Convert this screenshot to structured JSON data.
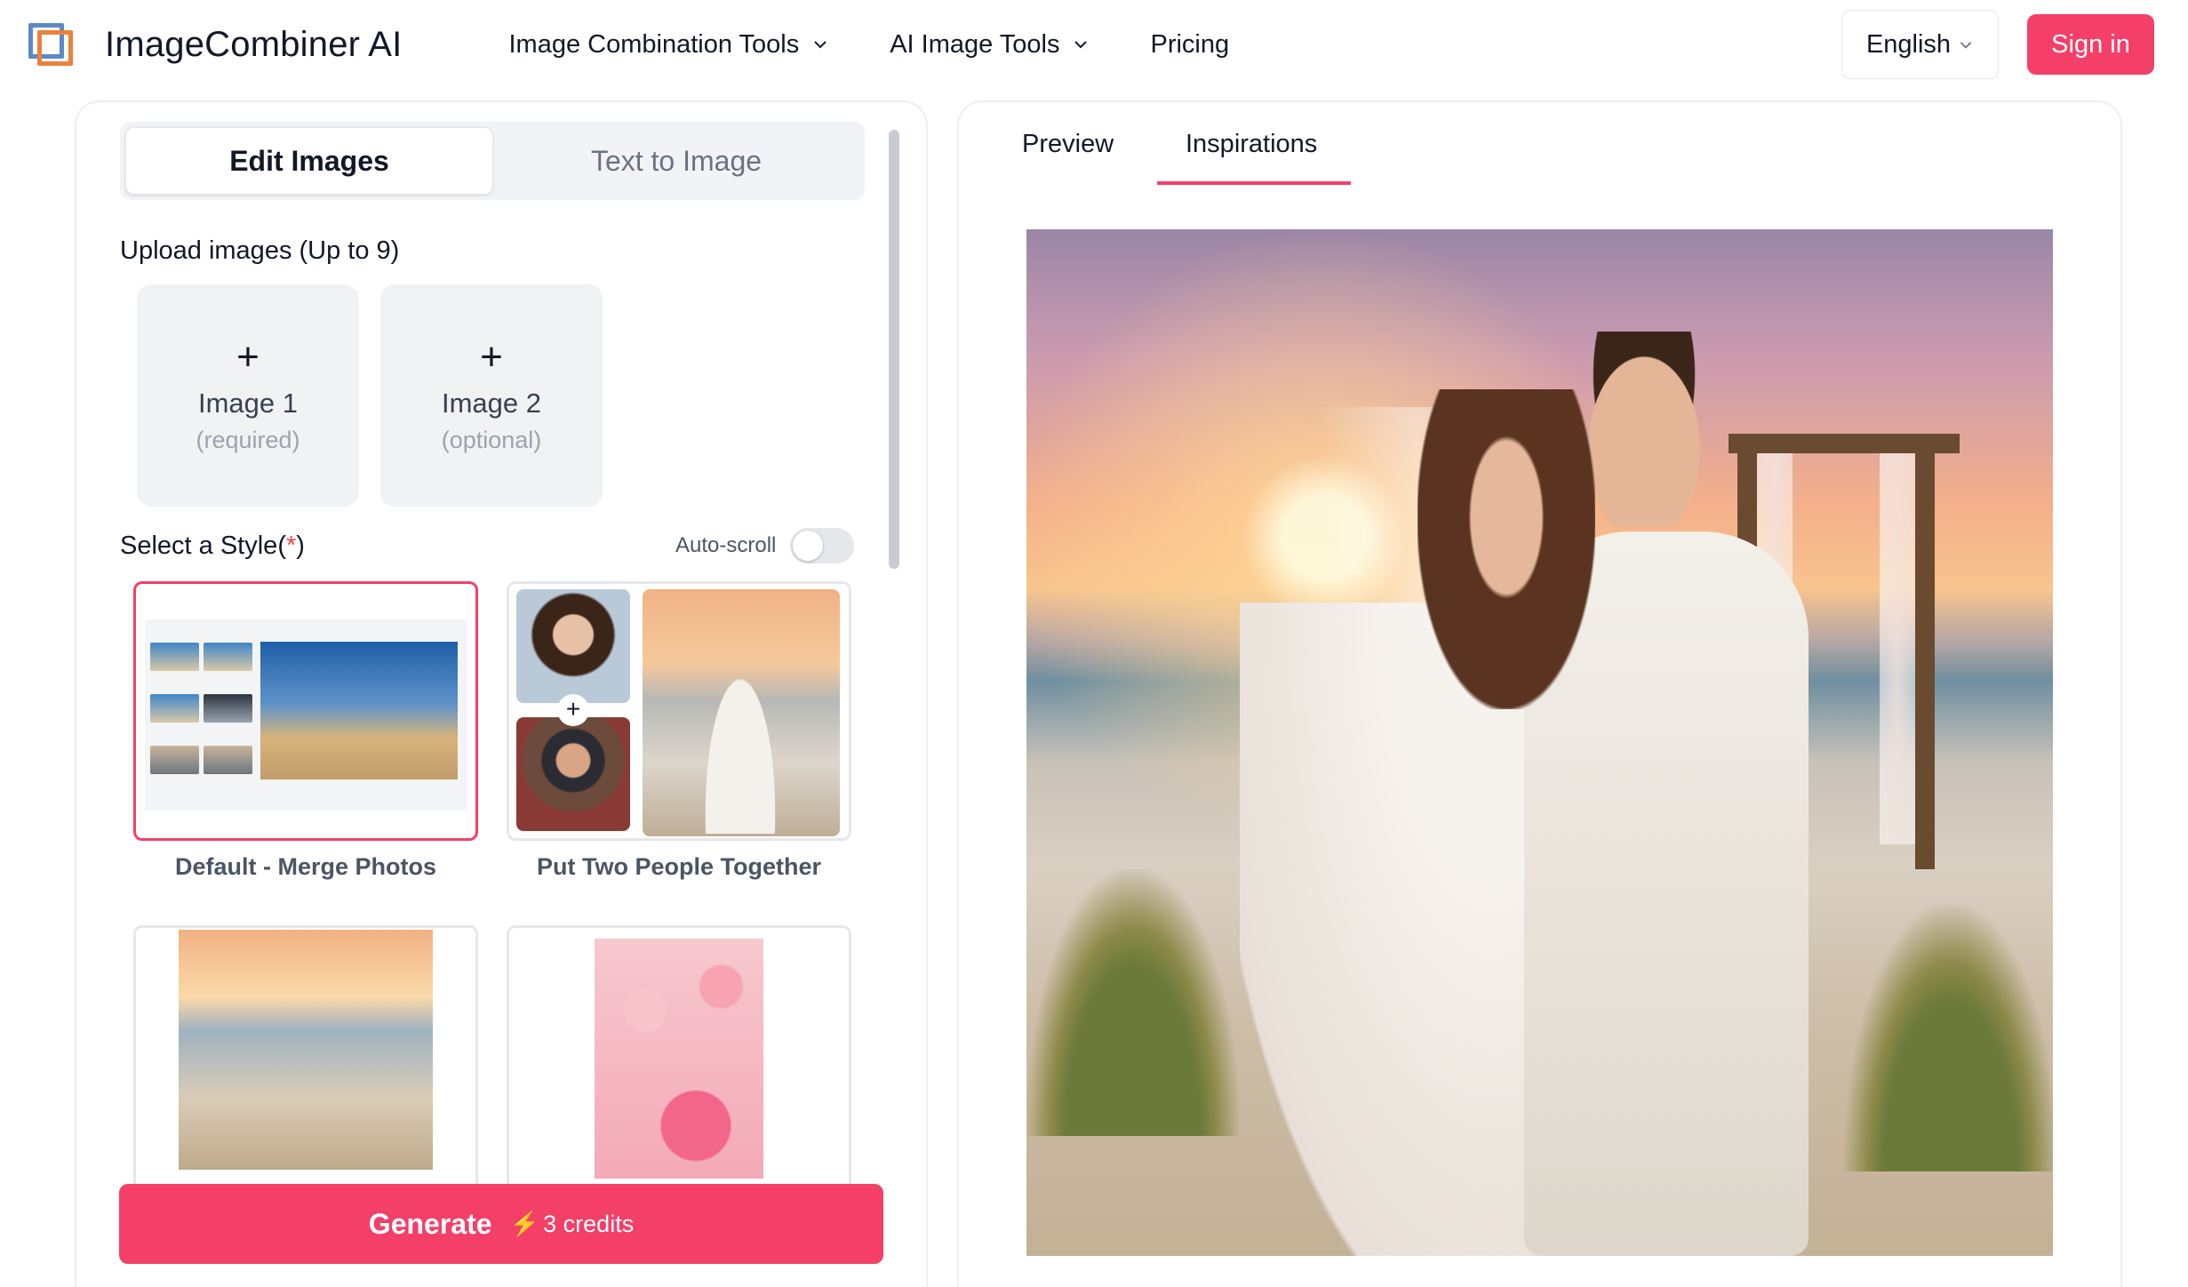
{
  "header": {
    "brand": "ImageCombiner AI",
    "nav": [
      {
        "label": "Image Combination Tools",
        "has_dropdown": true
      },
      {
        "label": "AI Image Tools",
        "has_dropdown": true
      },
      {
        "label": "Pricing",
        "has_dropdown": false
      }
    ],
    "language": "English",
    "sign_in": "Sign in"
  },
  "editor": {
    "mode_tabs": [
      {
        "label": "Edit Images",
        "active": true
      },
      {
        "label": "Text to Image",
        "active": false
      }
    ],
    "upload_label": "Upload images (Up to 9)",
    "uploads": [
      {
        "plus": "+",
        "name": "Image 1",
        "note": "(required)"
      },
      {
        "plus": "+",
        "name": "Image 2",
        "note": "(optional)"
      }
    ],
    "style_label": "Select a Style(",
    "style_required": "*",
    "style_label_close": ")",
    "auto_scroll_label": "Auto-scroll",
    "auto_scroll_on": false,
    "styles": [
      {
        "label": "Default - Merge Photos",
        "selected": true
      },
      {
        "label": "Put Two People Together",
        "selected": false
      },
      {
        "label": "",
        "selected": false
      },
      {
        "label": "",
        "selected": false
      }
    ],
    "combine_plus": "+",
    "generate": {
      "label": "Generate",
      "bolt": "⚡",
      "credits": "3 credits"
    }
  },
  "preview_panel": {
    "tabs": [
      {
        "label": "Preview",
        "active": false
      },
      {
        "label": "Inspirations",
        "active": true
      }
    ]
  },
  "colors": {
    "accent": "#f43f68",
    "logo_blue": "#5b8ac6",
    "logo_orange": "#e9823c"
  }
}
